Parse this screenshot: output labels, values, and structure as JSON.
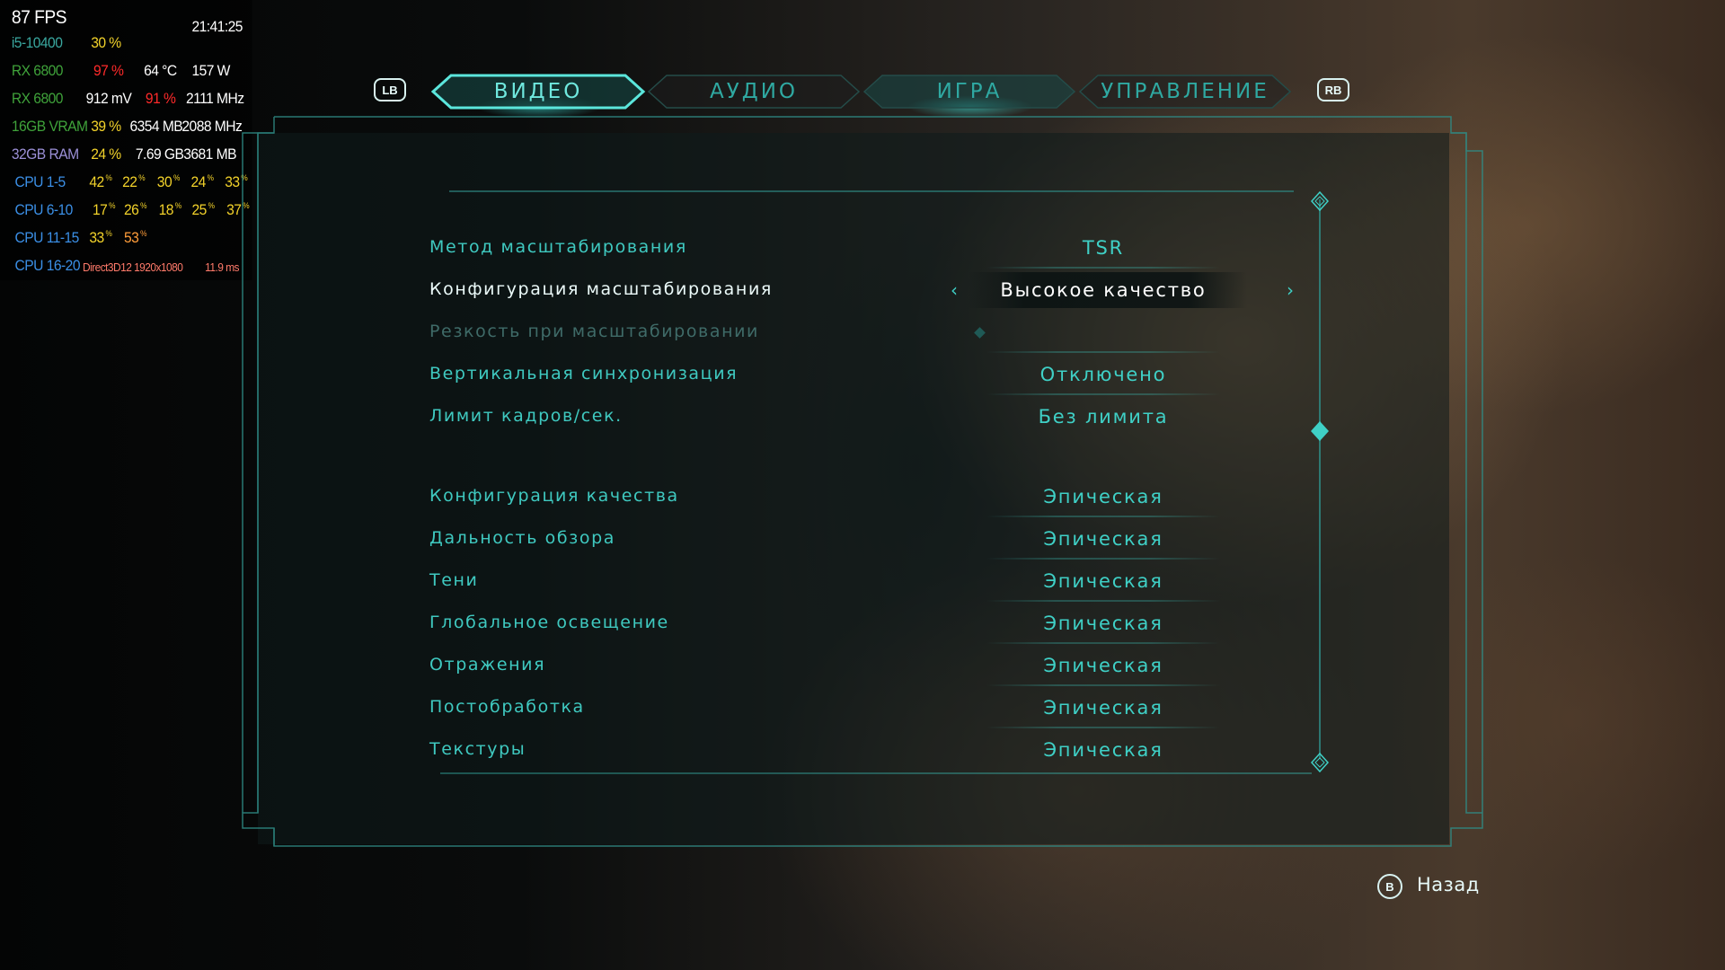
{
  "osd": {
    "fps": "87 FPS",
    "clock": "21:41:25",
    "cpu_name": "i5-10400",
    "cpu_load": "30 %",
    "gpu_name_1": "RX 6800",
    "gpu_load": "97 %",
    "gpu_temp": "64 °C",
    "gpu_power": "157 W",
    "gpu_name_2": "RX 6800",
    "gpu_voltage": "912 mV",
    "gpu_load_2": "91 %",
    "gpu_clock": "2111 MHz",
    "vram_name": "16GB VRAM",
    "vram_load": "39 %",
    "vram_used": "6354 MB",
    "vram_clock": "2088 MHz",
    "ram_name": "32GB RAM",
    "ram_load": "24 %",
    "ram_used": "7.69 GB",
    "ram_clock": "3681 MB",
    "cpu_groups": [
      {
        "label": "CPU 1-5",
        "values": [
          "42",
          "22",
          "30",
          "24",
          "33"
        ]
      },
      {
        "label": "CPU 6-10",
        "values": [
          "17",
          "26",
          "18",
          "25",
          "37"
        ]
      },
      {
        "label": "CPU 11-15",
        "values": [
          "33",
          "53"
        ]
      },
      {
        "label": "CPU 16-20",
        "api": "Direct3D12 1920x1080",
        "frametime": "11.9 ms"
      }
    ],
    "pct_symbol": "%"
  },
  "tabs": {
    "lb": "LB",
    "rb": "RB",
    "items": [
      {
        "label": "ВИДЕО",
        "active": true
      },
      {
        "label": "АУДИО",
        "active": false
      },
      {
        "label": "ИГРА",
        "active": false
      },
      {
        "label": "УПРАВЛЕНИЕ",
        "active": false
      }
    ]
  },
  "settings": {
    "rows": [
      {
        "label": "Метод масштабирования",
        "value": "TSR"
      },
      {
        "label": "Конфигурация масштабирования",
        "value": "Высокое качество",
        "selected": true
      },
      {
        "label": "Резкость при масштабировании",
        "value": "",
        "disabled": true
      },
      {
        "label": "Вертикальная синхронизация",
        "value": "Отключено"
      },
      {
        "label": "Лимит кадров/сек.",
        "value": "Без лимита"
      },
      {
        "label": "Конфигурация качества",
        "value": "Эпическая"
      },
      {
        "label": "Дальность обзора",
        "value": "Эпическая"
      },
      {
        "label": "Тени",
        "value": "Эпическая"
      },
      {
        "label": "Глобальное освещение",
        "value": "Эпическая"
      },
      {
        "label": "Отражения",
        "value": "Эпическая"
      },
      {
        "label": "Постобработка",
        "value": "Эпическая"
      },
      {
        "label": "Текстуры",
        "value": "Эпическая"
      }
    ],
    "arrow_left": "‹",
    "arrow_right": "›"
  },
  "footer": {
    "back_button": "B",
    "back_label": "Назад"
  },
  "colors": {
    "accent": "#3fd0c6",
    "accent_bright": "#6fe8de",
    "frame": "#2f8c86"
  }
}
